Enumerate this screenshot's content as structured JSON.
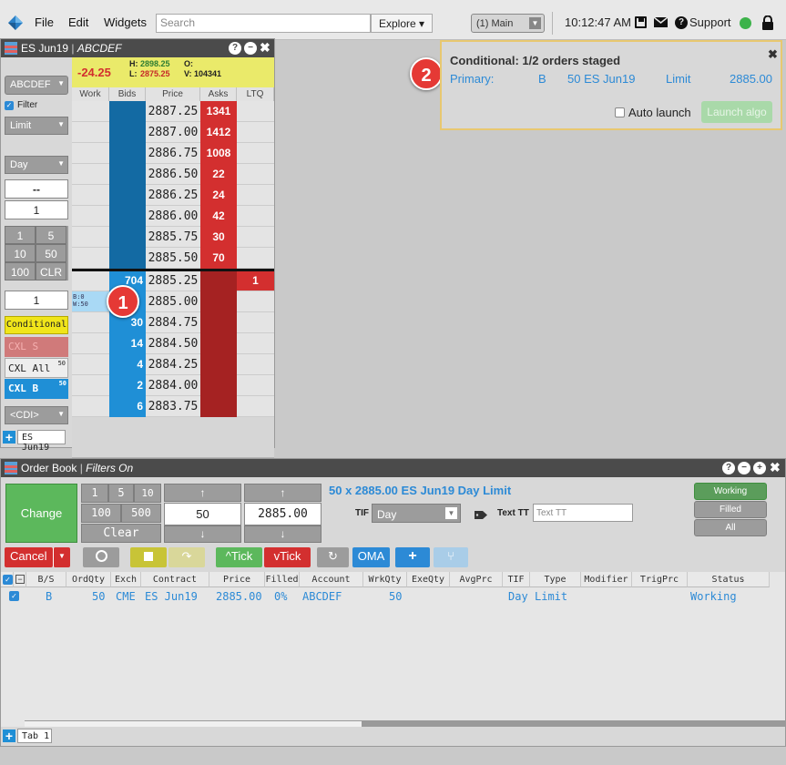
{
  "menu": {
    "file": "File",
    "edit": "Edit",
    "widgets": "Widgets"
  },
  "search": {
    "placeholder": "Search"
  },
  "explore": {
    "label": "Explore ▾"
  },
  "workspace": {
    "label": "(1) Main"
  },
  "clock": {
    "time": "10:12:47 AM"
  },
  "support": {
    "label": "Support"
  },
  "status_color": "#3cb34a",
  "md_trader": {
    "title_contract": "ES Jun19",
    "title_account": "ABCDEF",
    "change": "-24.25",
    "high_label": "H:",
    "high": "2898.25",
    "low_label": "L:",
    "low": "2875.25",
    "open_label": "O:",
    "volume_label": "V:",
    "volume": "104341",
    "account_select": "ABCDEF",
    "filter_label": "Filter",
    "order_type": "Limit",
    "tif": "Day",
    "blank_field": "--",
    "qty_field": "1",
    "qty_buttons": [
      "1",
      "5",
      "10",
      "50",
      "100",
      "CLR"
    ],
    "order_qty": "1",
    "conditional_btn": "Conditional",
    "cxl_s": "CXL S",
    "cxl_all": "CXL All",
    "cxl_all_count": "50",
    "cxl_b": "CXL B",
    "cxl_b_count": "50",
    "cdi": "<CDI>",
    "tab": "ES Jun19",
    "columns": [
      "Work",
      "Bids",
      "Price",
      "Asks",
      "LTQ"
    ],
    "working_info": [
      "B:0",
      "W:50"
    ],
    "rows": [
      {
        "price": "2887.25",
        "bid": "",
        "ask": "1341",
        "ltq": ""
      },
      {
        "price": "2887.00",
        "bid": "",
        "ask": "1412",
        "ltq": ""
      },
      {
        "price": "2886.75",
        "bid": "",
        "ask": "1008",
        "ltq": ""
      },
      {
        "price": "2886.50",
        "bid": "",
        "ask": "22",
        "ltq": ""
      },
      {
        "price": "2886.25",
        "bid": "",
        "ask": "24",
        "ltq": ""
      },
      {
        "price": "2886.00",
        "bid": "",
        "ask": "42",
        "ltq": ""
      },
      {
        "price": "2885.75",
        "bid": "",
        "ask": "30",
        "ltq": ""
      },
      {
        "price": "2885.50",
        "bid": "",
        "ask": "70",
        "ltq": ""
      },
      {
        "price": "2885.25",
        "bid": "704",
        "ask": "",
        "ltq": "1"
      },
      {
        "price": "2885.00",
        "bid": "",
        "ask": "",
        "ltq": ""
      },
      {
        "price": "2884.75",
        "bid": "30",
        "ask": "",
        "ltq": ""
      },
      {
        "price": "2884.50",
        "bid": "14",
        "ask": "",
        "ltq": ""
      },
      {
        "price": "2884.25",
        "bid": "4",
        "ask": "",
        "ltq": ""
      },
      {
        "price": "2884.00",
        "bid": "2",
        "ask": "",
        "ltq": ""
      },
      {
        "price": "2883.75",
        "bid": "6",
        "ask": "",
        "ltq": ""
      }
    ]
  },
  "callouts": {
    "one": "1",
    "two": "2"
  },
  "conditional": {
    "title": "Conditional: 1/2 orders staged",
    "primary_label": "Primary:",
    "side": "B",
    "qty_contract": "50 ES Jun19",
    "type": "Limit",
    "price": "2885.00",
    "auto_launch": "Auto launch",
    "launch_btn": "Launch algo"
  },
  "order_book": {
    "title": "Order Book",
    "filters": "Filters On",
    "change_btn": "Change",
    "qty_buttons": [
      "1",
      "5",
      "10",
      "100",
      "500"
    ],
    "clear_btn": "Clear",
    "qty_value": "50",
    "price_value": "2885.00",
    "summary": "50 x 2885.00 ES Jun19 Day Limit",
    "tif_label": "TIF",
    "tif_value": "Day",
    "text_tt_label": "Text TT",
    "text_tt_placeholder": "Text TT",
    "filter_working": "Working",
    "filter_filled": "Filled",
    "filter_all": "All",
    "cancel_btn": "Cancel",
    "tick_up": "Tick",
    "tick_down": "Tick",
    "oma_btn": "OMA",
    "columns": [
      "B/S",
      "OrdQty",
      "Exch",
      "Contract",
      "Price",
      "Filled",
      "Account",
      "WrkQty",
      "ExeQty",
      "AvgPrc",
      "TIF",
      "Type",
      "Modifier",
      "TrigPrc",
      "Status"
    ],
    "order_row": {
      "bs": "B",
      "ordqty": "50",
      "exch": "CME",
      "contract": "ES Jun19",
      "price": "2885.00",
      "filled": "0%",
      "account": "ABCDEF",
      "wrkqty": "50",
      "tif": "Day",
      "type": "Limit",
      "status": "Working"
    },
    "tab": "Tab 1"
  }
}
